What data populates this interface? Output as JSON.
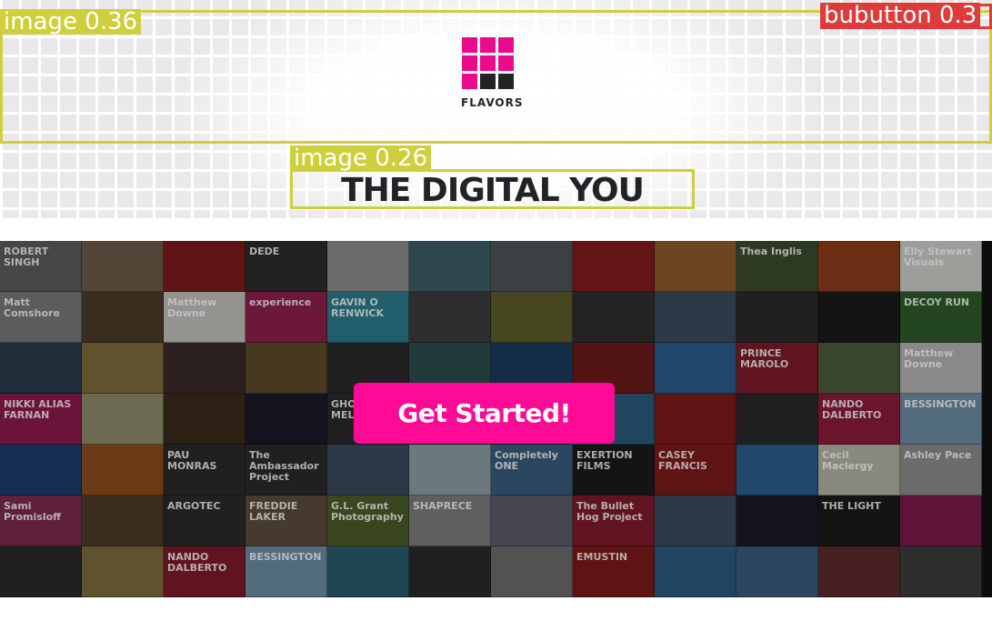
{
  "brand": {
    "name": "FLAVORS",
    "logo_colors": {
      "pink": "#ec0a8c",
      "dark": "#222327"
    },
    "logo_cells": [
      "pink",
      "pink",
      "pink",
      "pink",
      "pink",
      "pink",
      "pink",
      "dark",
      "dark"
    ]
  },
  "headline": "THE DIGITAL YOU",
  "cta": {
    "label": "Get Started!",
    "color": "#ff0a96"
  },
  "overlays": [
    {
      "label": "image 0.36"
    },
    {
      "label": "image 0.26"
    },
    {
      "label": "bubutton 0.3"
    }
  ],
  "mosaic": {
    "tiles": [
      {
        "label": "ROBERT SINGH",
        "color": "#5a5a5a"
      },
      {
        "label": "",
        "color": "#6b5a4a"
      },
      {
        "label": "",
        "color": "#7a1b1b"
      },
      {
        "label": "DEDE",
        "color": "#2b2b2b"
      },
      {
        "label": "",
        "color": "#8a8a88"
      },
      {
        "label": "",
        "color": "#3c5b63"
      },
      {
        "label": "",
        "color": "#4d5356"
      },
      {
        "label": "",
        "color": "#7f1a1a"
      },
      {
        "label": "",
        "color": "#8a5a2a"
      },
      {
        "label": "Thea Inglis",
        "color": "#3b4a2e"
      },
      {
        "label": "",
        "color": "#8a3a1a"
      },
      {
        "label": "Elly Stewart Visuals",
        "color": "#c9c9c4"
      },
      {
        "label": "Matt Comshore",
        "color": "#767676"
      },
      {
        "label": "",
        "color": "#4a3a2a"
      },
      {
        "label": "Matthew Downe",
        "color": "#bdbdb8"
      },
      {
        "label": "experience",
        "color": "#8a1f4a"
      },
      {
        "label": "GAVIN O RENWICK",
        "color": "#2a7a8a"
      },
      {
        "label": "",
        "color": "#3a3a3a"
      },
      {
        "label": "",
        "color": "#5a5a2a"
      },
      {
        "label": "",
        "color": "#2e2e2e"
      },
      {
        "label": "",
        "color": "#3a4a5a"
      },
      {
        "label": "",
        "color": "#2a2a2a"
      },
      {
        "label": "",
        "color": "#1a1a1a"
      },
      {
        "label": "DECOY RUN",
        "color": "#2e5a2a"
      },
      {
        "label": "",
        "color": "#2a3a4a"
      },
      {
        "label": "",
        "color": "#7a6a3a"
      },
      {
        "label": "",
        "color": "#3a2a2a"
      },
      {
        "label": "",
        "color": "#5a4a2a"
      },
      {
        "label": "",
        "color": "#2a2a2a"
      },
      {
        "label": "",
        "color": "#2a4a4a"
      },
      {
        "label": "",
        "color": "#1a3a5a"
      },
      {
        "label": "",
        "color": "#6a1a1a"
      },
      {
        "label": "",
        "color": "#2a5a8a"
      },
      {
        "label": "PRINCE MAROLO",
        "color": "#7a1a2a"
      },
      {
        "label": "",
        "color": "#4a5a3a"
      },
      {
        "label": "Matthew Downe",
        "color": "#b0b0ad"
      },
      {
        "label": "NIKKI ALIAS FARNAN",
        "color": "#8a1a4a"
      },
      {
        "label": "",
        "color": "#8a8a6a"
      },
      {
        "label": "",
        "color": "#3a2a1a"
      },
      {
        "label": "",
        "color": "#1a1a2a"
      },
      {
        "label": "GHOST & MEL",
        "color": "#2a2a2a"
      },
      {
        "label": "",
        "color": "#2a2a2a"
      },
      {
        "label": "",
        "color": "#2a2a2a"
      },
      {
        "label": "",
        "color": "#2a5a7a"
      },
      {
        "label": "",
        "color": "#7a1a1a"
      },
      {
        "label": "",
        "color": "#2a2a2a"
      },
      {
        "label": "NANDO DALBERTO",
        "color": "#8a1a3a"
      },
      {
        "label": "BESSINGTON",
        "color": "#6a8aa0"
      },
      {
        "label": "",
        "color": "#1a3a6a"
      },
      {
        "label": "",
        "color": "#8a4a1a"
      },
      {
        "label": "PAU MONRAS",
        "color": "#2a2a2a"
      },
      {
        "label": "The Ambassador Project",
        "color": "#2a2a2a"
      },
      {
        "label": "",
        "color": "#3a4a5a"
      },
      {
        "label": "",
        "color": "#8a9aa0"
      },
      {
        "label": "Completely ONE",
        "color": "#3a5a7a"
      },
      {
        "label": "EXERTION FILMS",
        "color": "#1a1a1a"
      },
      {
        "label": "CASEY FRANCIS",
        "color": "#7a1a1a"
      },
      {
        "label": "",
        "color": "#2a5a8a"
      },
      {
        "label": "Cecil Maclergy",
        "color": "#b0b0a0"
      },
      {
        "label": "Ashley Pace",
        "color": "#8a8a8a"
      },
      {
        "label": "Sami Promisloff",
        "color": "#7a2a4a"
      },
      {
        "label": "",
        "color": "#4a3a2a"
      },
      {
        "label": "ARGOTEC",
        "color": "#2a2a2a"
      },
      {
        "label": "FREDDIE LAKER",
        "color": "#5a4a3a"
      },
      {
        "label": "G.L. Grant Photography",
        "color": "#4a5a2a"
      },
      {
        "label": "SHAPRECE",
        "color": "#7a7a7a"
      },
      {
        "label": "",
        "color": "#5a5a6a"
      },
      {
        "label": "The Bullet Hog Project",
        "color": "#7a1a2a"
      },
      {
        "label": "",
        "color": "#3a4a5a"
      },
      {
        "label": "",
        "color": "#1a1a2a"
      },
      {
        "label": "THE LIGHT",
        "color": "#1a1a1a"
      },
      {
        "label": "",
        "color": "#7a1a4a"
      },
      {
        "label": "",
        "color": "#2a2a2a"
      },
      {
        "label": "",
        "color": "#7a6a3a"
      },
      {
        "label": "NANDO DALBERTO",
        "color": "#7a1a2a"
      },
      {
        "label": "BESSINGTON",
        "color": "#6a8aa0"
      },
      {
        "label": "",
        "color": "#2a5a6a"
      },
      {
        "label": "",
        "color": "#2a2a2a"
      },
      {
        "label": "",
        "color": "#6a6a6a"
      },
      {
        "label": "EMUSTIN",
        "color": "#7a1a1a"
      },
      {
        "label": "",
        "color": "#2a5a7a"
      },
      {
        "label": "",
        "color": "#3a5a7a"
      },
      {
        "label": "",
        "color": "#5a2a2a"
      },
      {
        "label": "",
        "color": "#3a3a3a"
      }
    ]
  }
}
